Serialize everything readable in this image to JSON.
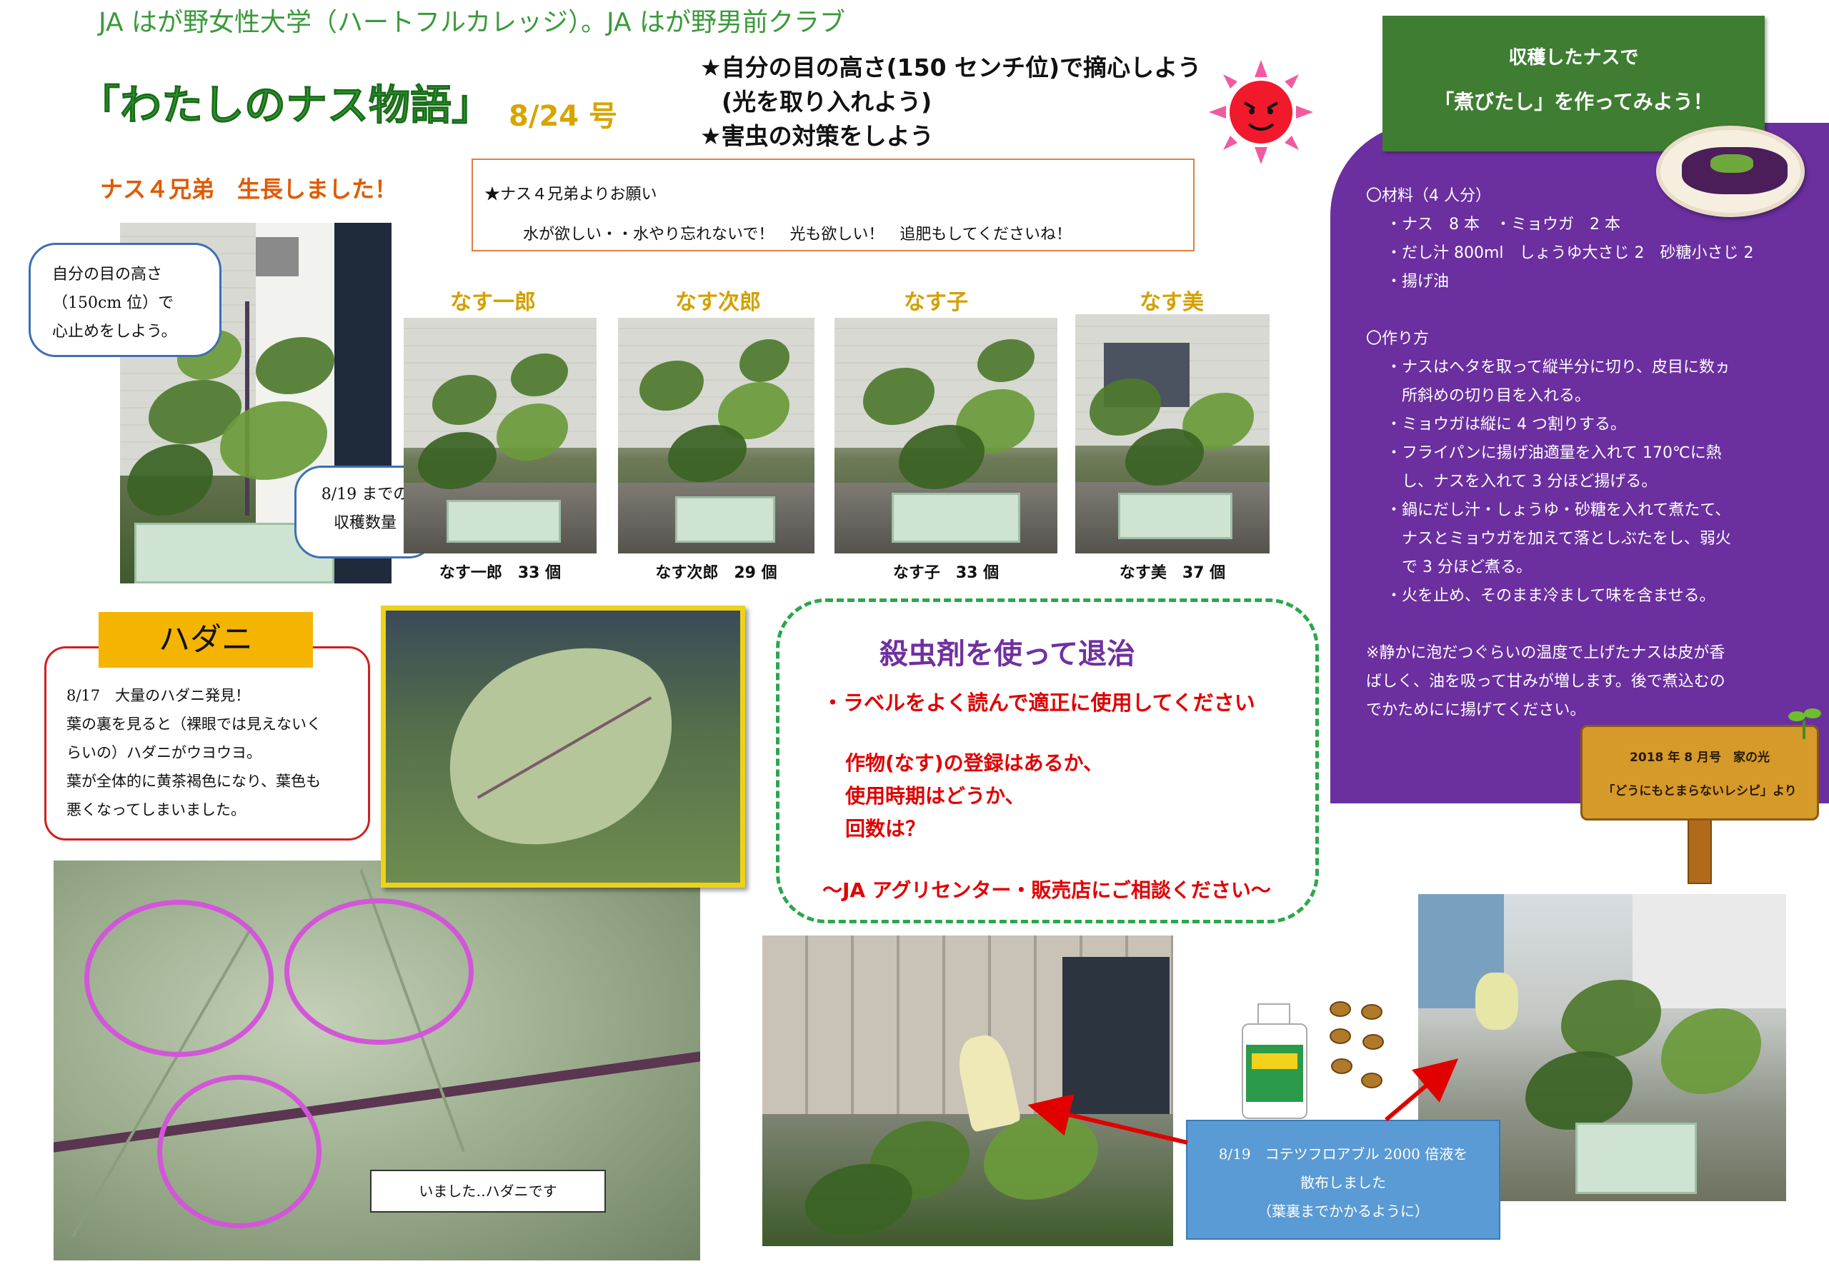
{
  "header": {
    "org_line": "JA はが野女性大学（ハートフルカレッジ）。JA はが野男前クラブ",
    "title": "「わたしのナス物語」",
    "issue": "8/24 号",
    "tips": [
      "★自分の目の高さ(150 センチ位)で摘心しよう",
      "(光を取り入れよう)",
      "★害虫の対策をしよう"
    ]
  },
  "growth": {
    "heading": "ナス４兄弟　生長しました！",
    "eye_callout": [
      "自分の目の高さ",
      "（150cm 位）で",
      "心止めをしよう。"
    ],
    "harvest_callout": [
      "8/19 までの",
      "収穫数量"
    ],
    "request_box": {
      "title": "★ナス４兄弟よりお願い",
      "body": "水が欲しい・・水やり忘れないで！　光も欲しい！　追肥もしてくださいね！"
    },
    "plants": [
      {
        "name": "なす一郎",
        "count": "なす一郎　33 個"
      },
      {
        "name": "なす次郎",
        "count": "なす次郎　29 個"
      },
      {
        "name": "なす子",
        "count": "なす子　33 個"
      },
      {
        "name": "なす美",
        "count": "なす美　37 個"
      }
    ]
  },
  "mite": {
    "heading": "ハダニ",
    "text": [
      "8/17　大量のハダニ発見！",
      "葉の裏を見ると（裸眼では見えないく",
      "らいの）ハダニがウヨウヨ。",
      "葉が全体的に黄茶褐色になり、葉色も",
      "悪くなってしまいました。"
    ],
    "photo_callout": "いました‥ハダニです"
  },
  "pesticide": {
    "title": "殺虫剤を使って退治",
    "subtitle": "・ラベルをよく読んで適正に使用してください",
    "checks": [
      "作物(なす)の登録はあるか、",
      "使用時期はどうか、",
      "回数は？"
    ],
    "consult": "～JA アグリセンター・販売店にご相談ください～"
  },
  "spray_note": [
    "8/19　コテツフロアブル 2000 倍液を",
    "散布しました",
    "（葉裏までかかるように）"
  ],
  "recipe": {
    "banner_line1": "収穫したナスで",
    "banner_line2": "「煮びたし」を作ってみよう！",
    "ingredients_heading": "〇材料（4 人分）",
    "ingredients": [
      "・ナス　8 本　・ミョウガ　2 本",
      "・だし汁 800ml　しょうゆ大さじ 2　砂糖小さじ 2",
      "・揚げ油"
    ],
    "steps_heading": "〇作り方",
    "steps": [
      "・ナスはヘタを取って縦半分に切り、皮目に数ヵ",
      "　所斜めの切り目を入れる。",
      "・ミョウガは縦に 4 つ割りする。",
      "・フライパンに揚げ油適量を入れて 170℃に熱",
      "　し、ナスを入れて 3 分ほど揚げる。",
      "・鍋にだし汁・しょうゆ・砂糖を入れて煮たて、",
      "　ナスとミョウガを加えて落としぶたをし、弱火",
      "　で 3 分ほど煮る。",
      "・火を止め、そのまま冷まして味を含ませる。"
    ],
    "note": [
      "※静かに泡だつぐらいの温度で上げたナスは皮が香",
      "ばしく、油を吸って甘みが増します。後で煮込むの",
      "でかためにに揚げてください。"
    ],
    "sign_line1": "2018 年 8 月号　家の光",
    "sign_line2": "「どうにもとまらないレシピ」より"
  },
  "colors": {
    "title_green": "#2f9a2f",
    "issue_yellow": "#d9a400",
    "purple": "#6b2fa0",
    "banner_green": "#3f7d32",
    "dashed_green": "#2aa84a",
    "red": "#e00000",
    "callout_blue": "#3d6fb5",
    "circle_magenta": "#d256d8",
    "note_blue": "#5b9bd5"
  }
}
